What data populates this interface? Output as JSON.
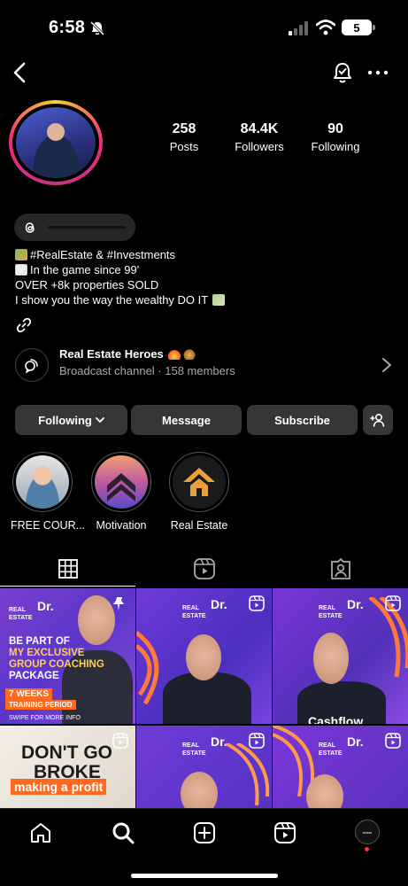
{
  "status_bar": {
    "time": "6:58",
    "battery": "5"
  },
  "profile": {
    "stats": [
      {
        "value": "258",
        "label": "Posts"
      },
      {
        "value": "84.4K",
        "label": "Followers"
      },
      {
        "value": "90",
        "label": "Following"
      }
    ],
    "bio": [
      "#RealEstate & #Investments",
      "In the game since 99'",
      "OVER +8k properties SOLD",
      "I show you the way the wealthy DO IT"
    ]
  },
  "broadcast": {
    "title": "Real Estate Heroes",
    "subtitle": "Broadcast channel · 158 members"
  },
  "actions": {
    "following": "Following",
    "message": "Message",
    "subscribe": "Subscribe"
  },
  "highlights": [
    {
      "label": "FREE COUR..."
    },
    {
      "label": "Motivation"
    },
    {
      "label": "Real Estate"
    }
  ],
  "grid": {
    "brand": "REAL ESTATE",
    "brand_dr": "Dr.",
    "post1": {
      "line1": "BE PART OF",
      "line2": "MY EXCLUSIVE",
      "line3": "GROUP COACHING",
      "line4": "PACKAGE",
      "badge1": "7 WEEKS",
      "badge2": "TRAINING PERIOD",
      "swipe": "SWIPE FOR MORE INFO"
    },
    "post3": {
      "caption": "Cashflow"
    },
    "post4": {
      "line1": "DON'T GO",
      "line2": "BROKE",
      "line3": "making a profit"
    }
  },
  "bottom_nav": {
    "profile_label": "closer"
  },
  "colors": {
    "background": "#000000",
    "button": "#363636",
    "secondary_text": "#a8a8a8",
    "accent_orange": "#ff6a1f",
    "notification": "#ff3040"
  }
}
